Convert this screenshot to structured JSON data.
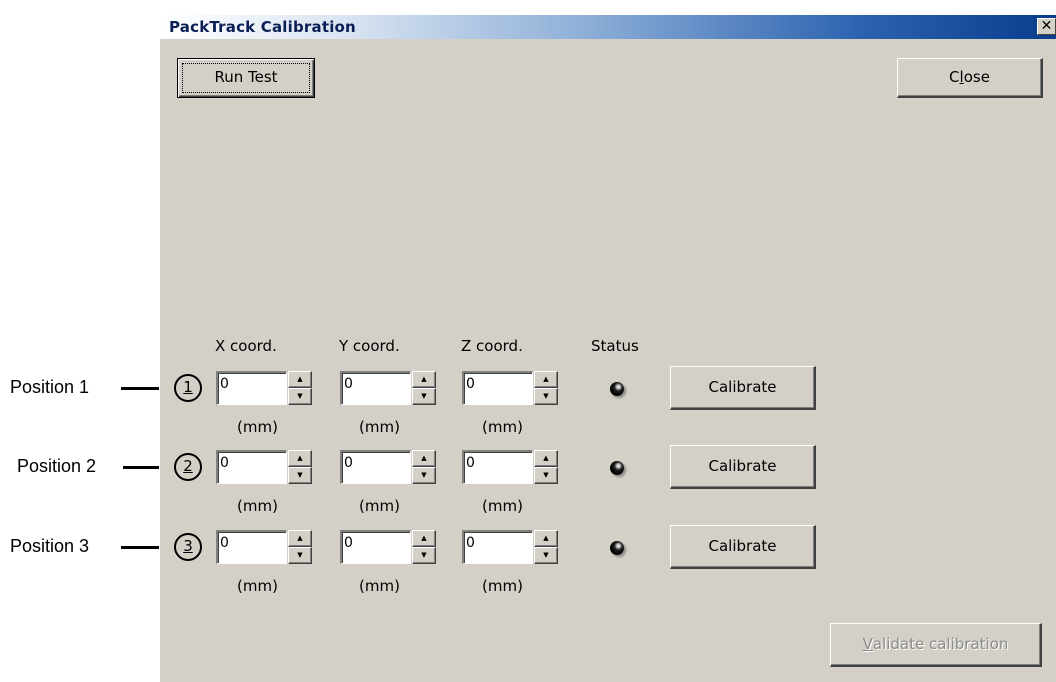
{
  "window": {
    "title": "PackTrack Calibration",
    "close_glyph": "✕",
    "run_test_label": "Run Test",
    "close_label_pre": "C",
    "close_label_ul": "l",
    "close_label_post": "ose"
  },
  "columns": {
    "x": "X coord.",
    "y": "Y coord.",
    "z": "Z coord.",
    "status": "Status"
  },
  "unit": "(mm)",
  "positions": [
    {
      "label": "Position 1",
      "number": "1",
      "x": "0",
      "y": "0",
      "z": "0",
      "calibrate_label": "Calibrate",
      "status_icon": "led-off-icon"
    },
    {
      "label": "Position 2",
      "number": "2",
      "x": "0",
      "y": "0",
      "z": "0",
      "calibrate_label": "Calibrate",
      "status_icon": "led-off-icon"
    },
    {
      "label": "Position 3",
      "number": "3",
      "x": "0",
      "y": "0",
      "z": "0",
      "calibrate_label": "Calibrate",
      "status_icon": "led-off-icon"
    }
  ],
  "validate": {
    "label_ul": "V",
    "label_rest": "alidate calibration",
    "disabled": true
  },
  "colors": {
    "dialog_bg": "#d4d0c8",
    "title_gradient_end": "#0a3c8c"
  }
}
